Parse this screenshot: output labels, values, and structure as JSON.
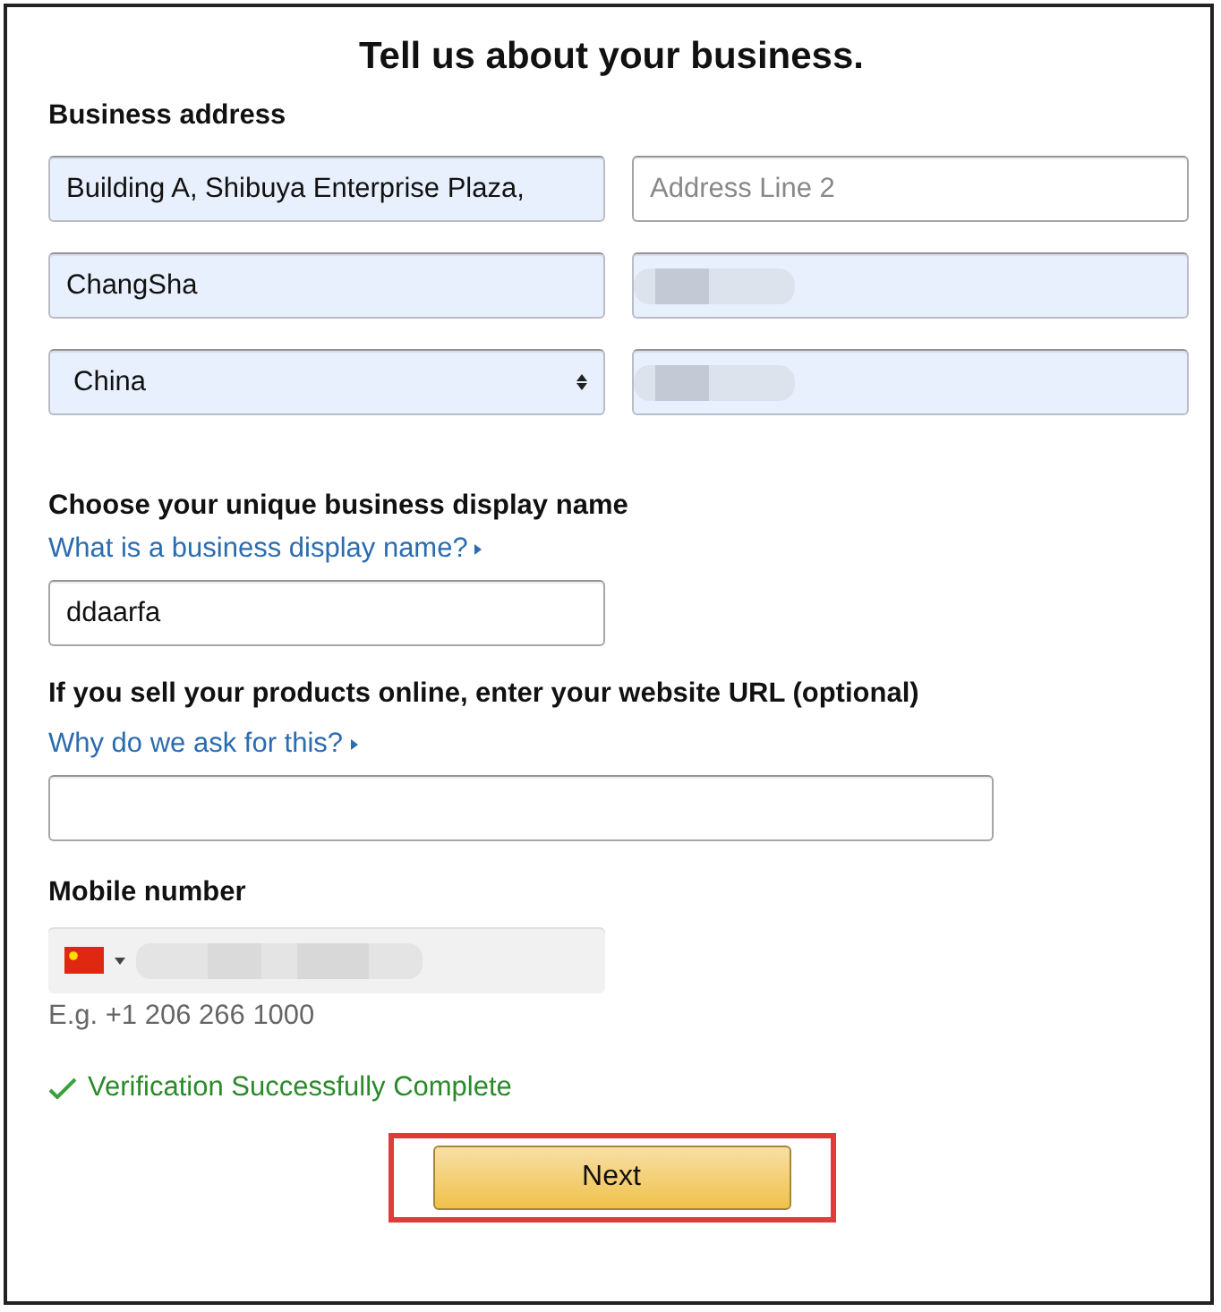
{
  "title": "Tell us about your business.",
  "address": {
    "label": "Business address",
    "fields": [
      {
        "kind": "text",
        "value": "Building A, Shibuya Enterprise Plaza,",
        "autofilled": true
      },
      {
        "kind": "text",
        "placeholder": "Address Line 2",
        "autofilled": false
      },
      {
        "kind": "text",
        "value": "ChangSha",
        "autofilled": true
      },
      {
        "kind": "redacted",
        "autofilled": true
      },
      {
        "kind": "select",
        "value": "China",
        "autofilled": true
      },
      {
        "kind": "redacted",
        "autofilled": true
      }
    ]
  },
  "display_name": {
    "label": "Choose your unique business display name",
    "link": "What is a business display name?",
    "value": "ddaarfa"
  },
  "website": {
    "label": "If you sell your products online, enter your website URL (optional)",
    "link": "Why do we ask for this?"
  },
  "mobile": {
    "label": "Mobile number",
    "hint": "E.g. +1 206 266 1000"
  },
  "verification": {
    "message": "Verification Successfully Complete",
    "verified": true
  },
  "next_button": {
    "label": "Next",
    "highlighted": true
  }
}
